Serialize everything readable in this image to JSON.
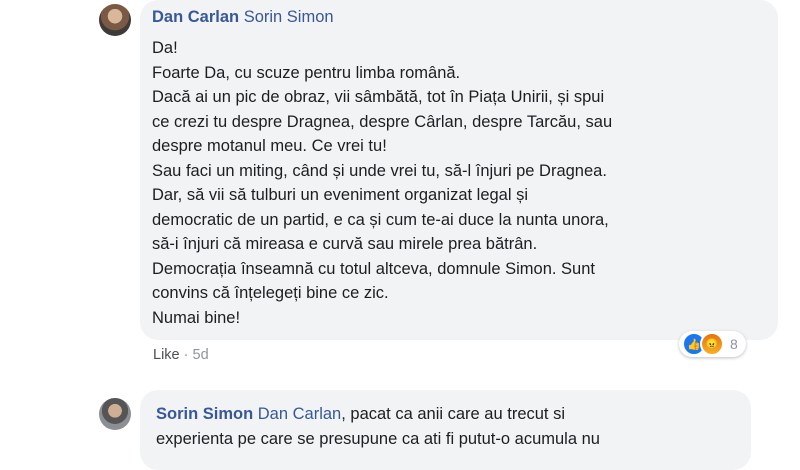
{
  "comments": [
    {
      "author": "Dan Carlan",
      "reply_to": "Sorin Simon",
      "lines": [
        "Da!",
        "Foarte Da, cu scuze pentru limba română.",
        "Dacă ai un pic de obraz, vii sâmbătă, tot în Piața Unirii, și spui",
        "ce crezi tu despre Dragnea, despre Cârlan, despre Tarcău, sau",
        "despre motanul meu. Ce vrei tu!",
        "Sau faci un miting, când și unde vrei tu, să-l înjuri pe Dragnea.",
        "Dar, să vii să tulburi un eveniment organizat legal și",
        "democratic de un partid, e ca și cum te-ai duce la nunta unora,",
        "să-i înjuri că mireasa e curvă sau mirele prea bătrân.",
        "Democrația înseamnă cu totul altceva, domnule Simon. Sunt",
        "convins că înțelegeți bine ce zic.",
        "Numai bine!"
      ],
      "actions": {
        "like": "Like",
        "separator": "·",
        "time": "5d"
      },
      "reactions": {
        "icons": [
          "like-icon",
          "angry-icon"
        ],
        "count": "8"
      }
    },
    {
      "author": "Sorin Simon",
      "reply_to": "Dan Carlan",
      "lines": [
        ", pacat ca anii care au trecut si",
        "experienta pe care se presupune ca ati fi putut-o acumula nu"
      ]
    }
  ],
  "colors": {
    "link": "#385898",
    "bubble": "#f2f3f5",
    "meta": "#90949c"
  }
}
